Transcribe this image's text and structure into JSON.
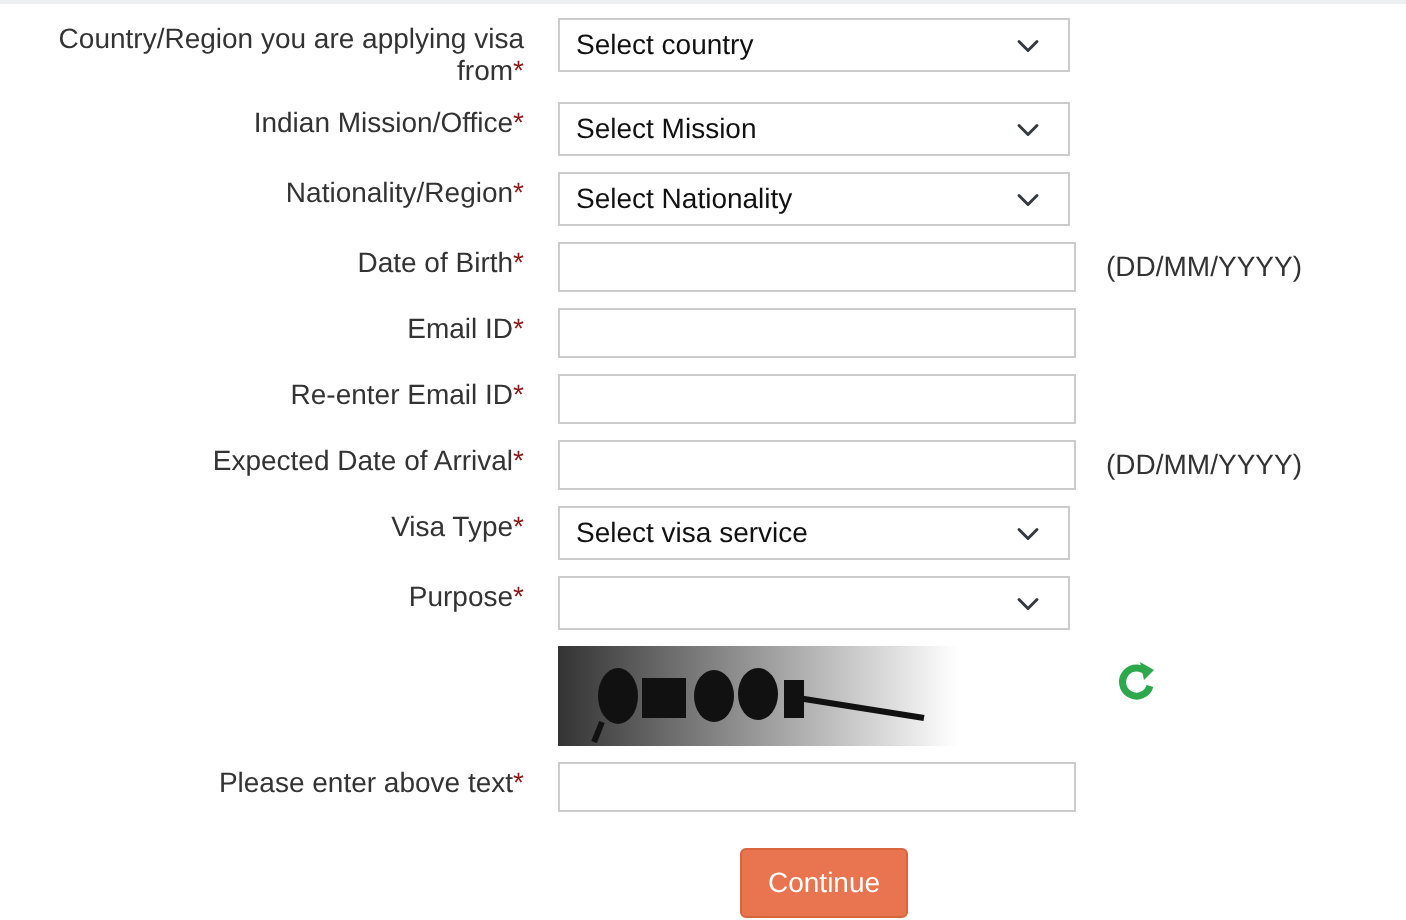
{
  "fields": [
    {
      "kind": "select",
      "label": "Country/Region you are applying visa from",
      "mark": "*",
      "value": "Select country"
    },
    {
      "kind": "select",
      "label": "Indian Mission/Office",
      "mark": "*",
      "value": "Select Mission"
    },
    {
      "kind": "select",
      "label": "Nationality/Region",
      "mark": "*",
      "value": "Select Nationality"
    },
    {
      "kind": "input",
      "label": "Date of Birth",
      "mark": "*",
      "hint": "(DD/MM/YYYY)"
    },
    {
      "kind": "input",
      "label": "Email ID",
      "mark": "*"
    },
    {
      "kind": "input",
      "label": "Re-enter Email ID",
      "mark": "*"
    },
    {
      "kind": "input",
      "label": "Expected Date of Arrival",
      "mark": "*",
      "hint": "(DD/MM/YYYY)"
    },
    {
      "kind": "select",
      "label": "Visa Type",
      "mark": "*",
      "value": "Select visa service"
    },
    {
      "kind": "select",
      "label": "Purpose",
      "mark": "*"
    },
    {
      "kind": "captcha"
    },
    {
      "kind": "input",
      "label": "Please enter above text",
      "mark": "*"
    }
  ],
  "button": "Continue"
}
